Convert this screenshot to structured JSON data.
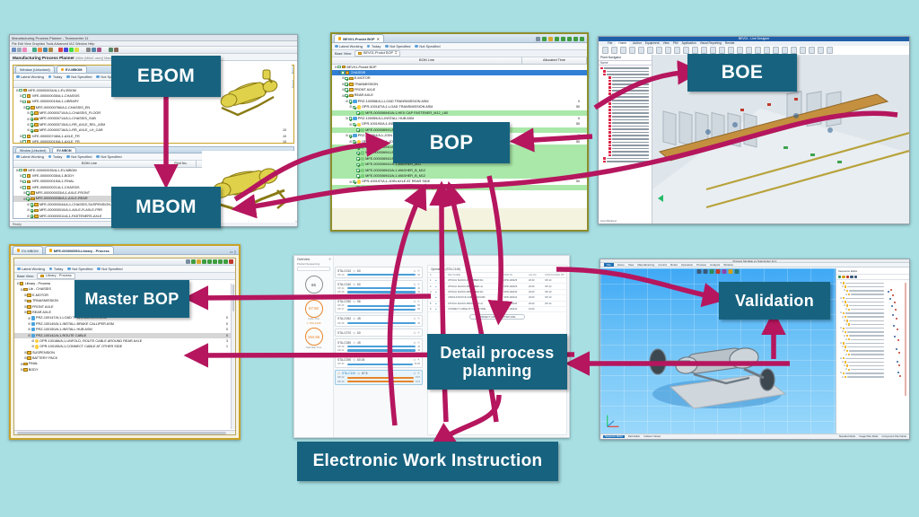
{
  "meta": {
    "background_color": "#a7dfe3",
    "label_color": "#17637f",
    "arrow_color": "#b5165e",
    "label_text_color": "#ffffff"
  },
  "labels": {
    "ebom": "EBOM",
    "mbom": "MBOM",
    "bop": "BOP",
    "boe": "BOE",
    "master_bop": "Master BOP",
    "detail_process_planning": "Detail process planning",
    "validation": "Validation",
    "electronic_work_instruction": "Electronic Work Instruction"
  },
  "panel_top_left": {
    "title": "Manufacturing Process Planner - Teamcenter 11",
    "menu": "File  Edit  View  Graphics  Tools  Advanced  IAC  Window  Help",
    "app_header": "Manufacturing Process Planner",
    "app_header_sub": "(Mike (Mike1.user)) Manufacturing (MBO) (DBE - MBPTABMO) (222.0.0)",
    "tabs": [
      {
        "label": "Window (Unlocked)",
        "active": false
      },
      {
        "label": "EV-MBOM",
        "active": true
      }
    ],
    "filters": [
      "Latest Working",
      "Today",
      "Not Specified",
      "Not Specified"
    ],
    "base_view_label": "Base View:",
    "base_view_value": "EV-MBOM",
    "columns_top": [
      "BOM Line",
      "Find No."
    ],
    "columns_bottom": [
      "BOM Line",
      "Find No.",
      "Usage Address",
      "Position Designator"
    ],
    "tree_top": [
      {
        "label": "MFE-000000034/A;1-EV-EBOM",
        "indent": 0,
        "num": ""
      },
      {
        "label": "MFE-000000035/A;1-CHASSIS",
        "indent": 1,
        "num": "10"
      },
      {
        "label": "MFE-000000015/A;1-LIBRARY",
        "indent": 1,
        "num": "10"
      },
      {
        "label": "MFE-000000766/A;1-CHASSIS_EN",
        "indent": 2,
        "num": "10"
      },
      {
        "label": "MFE-000000710/A;1-CHASSIS_FLOOR",
        "indent": 3,
        "num": "10"
      },
      {
        "label": "MFE-000000714/A;1-CHASSIS_SUB",
        "indent": 3,
        "num": "10"
      },
      {
        "label": "MFE-000000715/A;1-RR_AXLE_REL_ASM",
        "indent": 3,
        "num": "10"
      },
      {
        "label": "MFE-000000716/A;1-RR_AXLE_LH_CAR",
        "indent": 3,
        "num": "10"
      },
      {
        "label": "MFE-000000748/A;1-AXLE_FR",
        "indent": 1,
        "num": "10"
      },
      {
        "label": "MFE-000000015/A;1-AXLE_FR",
        "indent": 1,
        "num": "10"
      },
      {
        "label": "MFE-000000761/A;1-AXLE_FSM",
        "indent": 2,
        "num": "10"
      },
      {
        "label": "MFE-000000762/A;1-AXLE_RR",
        "indent": 2,
        "num": "10"
      },
      {
        "label": "MFE-000000764/A;1-AXLE_RR_ASM",
        "indent": 3,
        "num": "10"
      },
      {
        "label": "MFE-000000765/A;1-AXLE_RR_ASM",
        "indent": 3,
        "num": "10"
      },
      {
        "label": "MFE-000000766/A;1-AXLE_RR_LH_ASM",
        "indent": 3,
        "num": "10"
      },
      {
        "label": "MFE-000000084/A;1-WHEELS",
        "indent": 1,
        "num": "10"
      }
    ],
    "tree_bottom": [
      {
        "label": "MFE-000000035/A;1-EV-MBOM",
        "indent": 0,
        "num": "10"
      },
      {
        "label": "MFE-000000035/A;1-BODY",
        "indent": 1,
        "num": "10"
      },
      {
        "label": "MFE-000000015/A;1-FINAL",
        "indent": 1,
        "num": "10"
      },
      {
        "label": "MFE-000000021/A;1-CHASSIS",
        "indent": 1,
        "num": "10"
      },
      {
        "label": "MFE-000000033/A;1-AXLE-FRONT",
        "indent": 2,
        "num": "10"
      },
      {
        "label": "MFE-000000036/A;1-AXLE-REAR",
        "indent": 2,
        "num": "10",
        "selected": true
      },
      {
        "label": "MFE-000000044/A;1-CHASSIS-SUSPENSION-RR",
        "indent": 3,
        "num": "10"
      },
      {
        "label": "MFE-000000010/A;1-AXLE-R-AXLE-FRR",
        "indent": 3,
        "num": "10"
      },
      {
        "label": "MFE-000000011/A;1-FASTENERS-AXLE",
        "indent": 3,
        "num": "10"
      },
      {
        "label": "MFE-000000013/A;1-AXLE-SHOCK-ABSORBER-RH",
        "indent": 3,
        "num": "10"
      },
      {
        "label": "MFE-000000015/A;1-AXLE-SHOCK-ABSORBER-LH",
        "indent": 3,
        "num": "10"
      },
      {
        "label": "MFE-000000085/A;1-FINAL",
        "indent": 1,
        "num": "10"
      }
    ],
    "status": "Ready"
  },
  "panel_center": {
    "tab": "BEV01-Prodct BOP",
    "filters": [
      "Latest Working",
      "Today",
      "Not Specified",
      "Not Specified"
    ],
    "base_view_label": "Base View:",
    "base_view_value": "BEV01-Prodct BOP",
    "columns": [
      "BOM Line",
      "Allocated Time"
    ],
    "tree": [
      {
        "label": "BEV01-Prodct BOP",
        "indent": 0,
        "icon": "folder",
        "num": ""
      },
      {
        "label": "CHASSIS",
        "indent": 1,
        "icon": "folder",
        "num": "",
        "selected": true
      },
      {
        "label": "E-MOTOR",
        "indent": 2,
        "icon": "folder",
        "num": ""
      },
      {
        "label": "TRANMISSION",
        "indent": 2,
        "icon": "folder",
        "num": ""
      },
      {
        "label": "FRONT AXLE",
        "indent": 2,
        "icon": "folder",
        "num": ""
      },
      {
        "label": "REAR AXLE",
        "indent": 2,
        "icon": "folder",
        "num": ""
      },
      {
        "label": "PRZ-100058/A;1-LOAD TRANSMISSION ASM",
        "indent": 3,
        "icon": "proc",
        "num": "0"
      },
      {
        "label": "OPR-100187/A;1-LOAD TRANSMISSION ASM",
        "indent": 4,
        "icon": "op",
        "num": "50"
      },
      {
        "label": "MFE-000006940/A;1-HEX CAP FASTENER_M12_L80",
        "indent": 5,
        "icon": "part",
        "num": "",
        "green": true
      },
      {
        "label": "PRZ-100059/A;1-INSTALL HUB ASM",
        "indent": 3,
        "icon": "proc",
        "num": "0"
      },
      {
        "label": "OPR-100190/A;1-INSTALL HUB ASM",
        "indent": 4,
        "icon": "op",
        "num": "50"
      },
      {
        "label": "MFE-000006941/A;1-HEX NUT_M12",
        "indent": 5,
        "icon": "part",
        "num": "",
        "green": true
      },
      {
        "label": "PRZ-100064/A;1-JOIN AXLE",
        "indent": 3,
        "icon": "proc",
        "num": "0"
      },
      {
        "label": "OPR-100196/A;1-JOIN AXLE AT FRONT SIDE",
        "indent": 4,
        "icon": "op",
        "num": "50"
      },
      {
        "label": "MFE-000006940/A;1-HEX CAP FASTENER_M12_L80",
        "indent": 5,
        "icon": "part",
        "num": "",
        "green": true
      },
      {
        "label": "MFE-000006941/A;1-HEX NUT_M12",
        "indent": 5,
        "icon": "part",
        "num": "",
        "green": true
      },
      {
        "label": "MFE-000006942/A;1-WASHER_M12",
        "indent": 5,
        "icon": "part",
        "num": "",
        "green": true
      },
      {
        "label": "MFE-000006942/A;1-WASHER_M12",
        "indent": 5,
        "icon": "part",
        "num": "",
        "green": true
      },
      {
        "label": "MFE-000006943/A;1-WASHER_B_M12",
        "indent": 5,
        "icon": "part",
        "num": "",
        "green": true
      },
      {
        "label": "MFE-000006943/A;1-WASHER_B_M12",
        "indent": 5,
        "icon": "part",
        "num": "",
        "green": true
      },
      {
        "label": "OPR-100197/A;1-JOIN AXLE AT REAR SIDE",
        "indent": 4,
        "icon": "op",
        "num": "50"
      },
      {
        "label": "MFE-000006940/A;1-HEX CAP FASTENER_M12_L80",
        "indent": 5,
        "icon": "part",
        "num": "",
        "green": true
      }
    ]
  },
  "panel_top_right": {
    "title": "BEV01 - Line Designer",
    "ribbon_tabs": [
      "File",
      "Home",
      "Author",
      "Equipment",
      "View",
      "PMI",
      "Application",
      "Visual Reporting",
      "Render"
    ],
    "nav_title": "Plant Navigator",
    "nav_column": "Name",
    "footer": "Line Planned"
  },
  "panel_bottom_left": {
    "tabs": [
      {
        "label": "EV-MBOM",
        "active": false
      },
      {
        "label": "MFE-000006953-Library - Process",
        "active": true
      }
    ],
    "filters": [
      "Latest Working",
      "Today",
      "Not Specified",
      "Not Specified"
    ],
    "base_view_label": "Base View:",
    "base_view_value": "Library - Process",
    "tree": [
      {
        "label": "Library - Process",
        "indent": 0,
        "icon": "folder",
        "num": ""
      },
      {
        "label": "Lib - CHASSIS",
        "indent": 1,
        "icon": "folder",
        "num": ""
      },
      {
        "label": "E-MOTOR",
        "indent": 2,
        "icon": "folder",
        "num": ""
      },
      {
        "label": "TRNASMISSION",
        "indent": 2,
        "icon": "folder",
        "num": ""
      },
      {
        "label": "FRONT AXLE",
        "indent": 2,
        "icon": "folder",
        "num": ""
      },
      {
        "label": "REAR AXLE",
        "indent": 2,
        "icon": "folder",
        "num": ""
      },
      {
        "label": "PRZ-100147/A;1-LOAD TRANSMISSION ASM",
        "indent": 3,
        "icon": "proc",
        "num": "0"
      },
      {
        "label": "PRZ-100149/A;1-INSTALL BRAKE CALLIPER ASM",
        "indent": 3,
        "icon": "proc",
        "num": "0"
      },
      {
        "label": "PRZ-100150/A;1-INSTALL HUB ASM",
        "indent": 3,
        "icon": "proc",
        "num": "0"
      },
      {
        "label": "PRZ-100142/A;1-ROUTE CABLE",
        "indent": 3,
        "icon": "proc",
        "num": "0",
        "selected": true
      },
      {
        "label": "OPR-100188/A;1-UNFOLD, ROUTE CABLE AROUND REAR AXLE",
        "indent": 4,
        "icon": "op",
        "num": "3"
      },
      {
        "label": "OPR-100195/A;1-CONNECT CABLE AT OTHER SIDE",
        "indent": 4,
        "icon": "op",
        "num": "1"
      },
      {
        "label": "SUSPENSION",
        "indent": 2,
        "icon": "folder",
        "num": ""
      },
      {
        "label": "BATTERY PACK",
        "indent": 2,
        "icon": "folder",
        "num": ""
      },
      {
        "label": "FINAL",
        "indent": 1,
        "icon": "folder",
        "num": ""
      },
      {
        "label": "BODY",
        "indent": 1,
        "icon": "folder",
        "num": ""
      }
    ]
  },
  "panel_bottom_center": {
    "left_tab": "Overview",
    "section_title": "Product Sequencing",
    "gauges": [
      {
        "value": "65",
        "caption": "Takt Time",
        "accent": false
      },
      {
        "value": "67.50",
        "caption": "Cycle Time",
        "accent": true
      },
      {
        "value": "194.66",
        "caption": "Total Wait Time",
        "accent": true
      }
    ],
    "alert": "STA-C100",
    "stations": [
      {
        "name": "STA-C010",
        "time": "60",
        "ops": [
          {
            "id": "OP-10",
            "val": "60"
          }
        ]
      },
      {
        "name": "STA-C040",
        "time": "60",
        "ops": [
          {
            "id": "OP-14",
            "val": "40"
          },
          {
            "id": "OP-16",
            "val": "40"
          }
        ]
      },
      {
        "name": "STA-C050",
        "time": "56",
        "ops": [
          {
            "id": "OP-16",
            "val": "56"
          },
          {
            "id": "OP-17",
            "val": "56"
          }
        ]
      },
      {
        "name": "STA-C062",
        "time": "45",
        "ops": [
          {
            "id": "OP-18",
            "val": "45"
          }
        ]
      },
      {
        "name": "STA-C070",
        "time": "60",
        "ops": []
      },
      {
        "name": "STA-C080",
        "time": "45",
        "ops": [
          {
            "id": "OP-16",
            "val": "45"
          },
          {
            "id": "OP-11",
            "val": "45"
          }
        ]
      },
      {
        "name": "STA-C090",
        "time": "60.06",
        "ops": [
          {
            "id": "OP-13",
            "val": "60.06"
          }
        ]
      },
      {
        "name": "STA-C100",
        "time": "67.5",
        "ops": [
          {
            "id": "OP-12",
            "val": "67.5"
          },
          {
            "id": "OP-14",
            "val": "67.5"
          }
        ],
        "alert": true
      }
    ],
    "ops_title": "Operations (STA-C100)",
    "ops_columns": [
      "#",
      "",
      "",
      "REV NAME",
      "ITEM ID",
      "ALLOC",
      "ASSOCIATED PR"
    ],
    "ops_rows": [
      {
        "n": "1",
        "name": "ATTACH SHOCK ABSORBER RH",
        "item": "OPR-100225",
        "alloc": "20.00",
        "assoc": "OP-13"
      },
      {
        "n": "2",
        "name": "ATTACH SHOCK ABSORBER LH",
        "item": "OPR-100226",
        "alloc": "20.00",
        "assoc": "OP-14"
      },
      {
        "n": "3",
        "name": "ATTACH SHOCK ABSORBER RH",
        "item": "OPR-100240",
        "alloc": "20.00",
        "assoc": "OP-13"
      },
      {
        "n": "4",
        "name": "UNFOLD ROUTE CABLE AROUND",
        "item": "OPR-100241",
        "alloc": "20.00",
        "assoc": "OP-13"
      },
      {
        "n": "5",
        "name": "ATTACH SHOCK ABSORBER LH",
        "item": "OPR-100240",
        "alloc": "20.00",
        "assoc": "OP-14"
      },
      {
        "n": "6",
        "name": "CONNECT CABLE AT OTHER SIDE",
        "item": "OPR-100242",
        "alloc": "10.00",
        "assoc": ""
      }
    ],
    "chip": "CONNECT CABLE AT OTHER SIDE"
  },
  "panel_bottom_right": {
    "title": "Process Simulate ev Teamcenter 14.1",
    "ribbon_tabs": [
      "File",
      "Home",
      "View",
      "Manufacturing",
      "Control",
      "Robot",
      "Operation",
      "Process",
      "Analysis",
      "Window"
    ],
    "panel_title": "Sequence Editor",
    "footer_tabs": [
      "Sequence Editor",
      "Path Editor",
      "Collision Viewer"
    ],
    "footer_right": [
      "Standard Mode",
      "Usage Plan Mode",
      "Component Plan Mode"
    ]
  }
}
